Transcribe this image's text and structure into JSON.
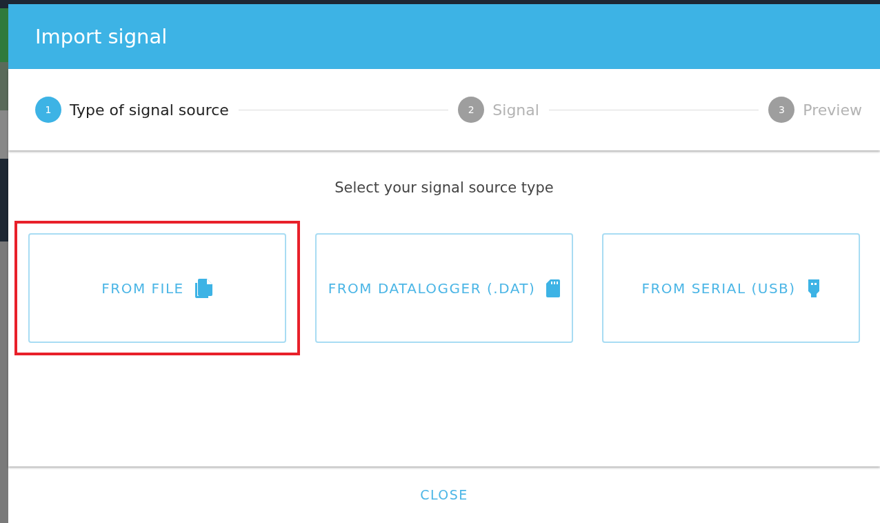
{
  "dialog": {
    "title": "Import signal"
  },
  "steps": [
    {
      "number": "1",
      "label": "Type of signal source",
      "selected": true
    },
    {
      "number": "2",
      "label": "Signal",
      "selected": false
    },
    {
      "number": "3",
      "label": "Preview",
      "selected": false
    }
  ],
  "prompt": "Select your signal source type",
  "options": [
    {
      "label": "FROM FILE",
      "kind": "file",
      "highlighted": true
    },
    {
      "label": "FROM DATALOGGER (.DAT)",
      "kind": "sdcard",
      "highlighted": false
    },
    {
      "label": "FROM SERIAL (USB)",
      "kind": "usb",
      "highlighted": false
    }
  ],
  "footer_button": "CLOSE"
}
